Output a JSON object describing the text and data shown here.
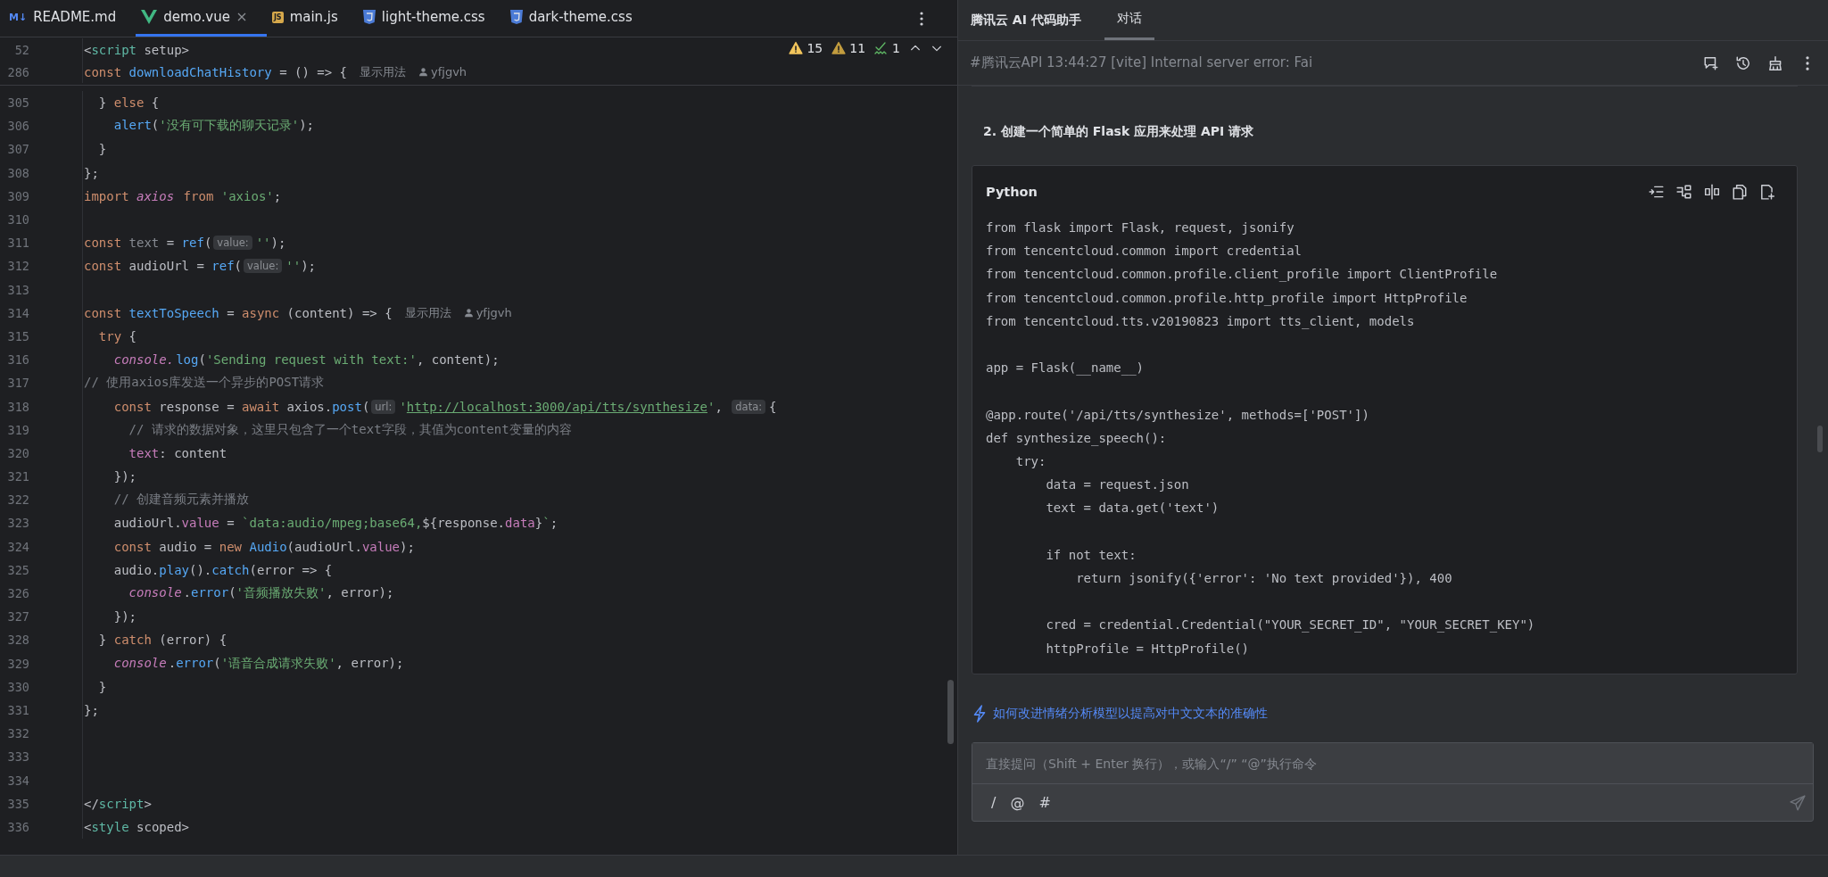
{
  "editor_tabs": [
    {
      "label": "README.md",
      "kind": "markdown",
      "icon_text": "M↓",
      "selected": false,
      "closable": false
    },
    {
      "label": "demo.vue",
      "kind": "vue",
      "selected": true,
      "closable": true
    },
    {
      "label": "main.js",
      "kind": "js",
      "icon_text": "JS",
      "selected": false,
      "closable": false
    },
    {
      "label": "light-theme.css",
      "kind": "css",
      "selected": false,
      "closable": false
    },
    {
      "label": "dark-theme.css",
      "kind": "css",
      "selected": false,
      "closable": false
    }
  ],
  "inspections": [
    {
      "kind": "warning",
      "count": "15"
    },
    {
      "kind": "weak_warning",
      "count": "11"
    },
    {
      "kind": "typo",
      "count": "1"
    }
  ],
  "sticky_lines": [
    {
      "number": "52",
      "tokens": [
        {
          "kind": "plain",
          "text": "<"
        },
        {
          "kind": "tag",
          "text": "script"
        },
        {
          "kind": "plain",
          "text": " setup>"
        }
      ]
    },
    {
      "number": "286",
      "tokens": [
        {
          "kind": "keyword",
          "text": "const "
        },
        {
          "kind": "function",
          "text": "downloadChatHistory"
        },
        {
          "kind": "plain",
          "text": " = () => {"
        }
      ],
      "usages": "显示用法",
      "author": "yfjgvh"
    }
  ],
  "lines": [
    {
      "number": "305",
      "tokens": [
        {
          "kind": "plain",
          "text": "  } "
        },
        {
          "kind": "keyword",
          "text": "else"
        },
        {
          "kind": "plain",
          "text": " {"
        }
      ]
    },
    {
      "number": "306",
      "tokens": [
        {
          "kind": "function",
          "text": "    alert"
        },
        {
          "kind": "plain",
          "text": "("
        },
        {
          "kind": "string",
          "text": "'没有可下载的聊天记录'"
        },
        {
          "kind": "plain",
          "text": ");"
        }
      ]
    },
    {
      "number": "307",
      "tokens": [
        {
          "kind": "plain",
          "text": "  }"
        }
      ]
    },
    {
      "number": "308",
      "tokens": [
        {
          "kind": "plain",
          "text": "};"
        }
      ]
    },
    {
      "number": "309",
      "tokens": [
        {
          "kind": "keyword",
          "text": "import "
        },
        {
          "kind": "global",
          "text": "axios"
        },
        {
          "kind": "keyword",
          "text": " from "
        },
        {
          "kind": "string",
          "text": "'axios'"
        },
        {
          "kind": "plain",
          "text": ";"
        }
      ]
    },
    {
      "number": "310"
    },
    {
      "number": "311",
      "tokens": [
        {
          "kind": "keyword",
          "text": "const "
        },
        {
          "kind": "unused",
          "text": "text"
        },
        {
          "kind": "plain",
          "text": " = "
        },
        {
          "kind": "function",
          "text": "ref"
        },
        {
          "kind": "plain",
          "text": "("
        },
        {
          "kind": "hint",
          "text": "value:"
        },
        {
          "kind": "string",
          "text": "''"
        },
        {
          "kind": "plain",
          "text": ");"
        }
      ]
    },
    {
      "number": "312",
      "tokens": [
        {
          "kind": "keyword",
          "text": "const "
        },
        {
          "kind": "plain",
          "text": "audioUrl = "
        },
        {
          "kind": "function",
          "text": "ref"
        },
        {
          "kind": "plain",
          "text": "("
        },
        {
          "kind": "hint",
          "text": "value:"
        },
        {
          "kind": "string",
          "text": "''"
        },
        {
          "kind": "plain",
          "text": ");"
        }
      ]
    },
    {
      "number": "313"
    },
    {
      "number": "314",
      "tokens": [
        {
          "kind": "keyword",
          "text": "const "
        },
        {
          "kind": "function",
          "text": "textToSpeech"
        },
        {
          "kind": "plain",
          "text": " = "
        },
        {
          "kind": "keyword",
          "text": "async "
        },
        {
          "kind": "plain",
          "text": "(content) => {"
        }
      ],
      "usages": "显示用法",
      "author": "yfjgvh"
    },
    {
      "number": "315",
      "tokens": [
        {
          "kind": "keyword",
          "text": "  try"
        },
        {
          "kind": "plain",
          "text": " {"
        }
      ]
    },
    {
      "number": "316",
      "tokens": [
        {
          "kind": "global",
          "text": "    console."
        },
        {
          "kind": "function",
          "text": "log"
        },
        {
          "kind": "plain",
          "text": "("
        },
        {
          "kind": "string",
          "text": "'Sending request with text:'"
        },
        {
          "kind": "plain",
          "text": ", content);"
        }
      ]
    },
    {
      "number": "317",
      "tokens": [
        {
          "kind": "comment",
          "text": "// 使用axios库发送一个异步的POST请求"
        }
      ]
    },
    {
      "number": "318",
      "tokens": [
        {
          "kind": "keyword",
          "text": "    const "
        },
        {
          "kind": "plain",
          "text": "response = "
        },
        {
          "kind": "keyword",
          "text": "await "
        },
        {
          "kind": "plain",
          "text": "axios."
        },
        {
          "kind": "function",
          "text": "post"
        },
        {
          "kind": "plain",
          "text": "("
        },
        {
          "kind": "hint",
          "text": "url:"
        },
        {
          "kind": "string",
          "text": "'"
        },
        {
          "kind": "url",
          "text": "http://localhost:3000/api/tts/synthesize"
        },
        {
          "kind": "string",
          "text": "'"
        },
        {
          "kind": "plain",
          "text": ", "
        },
        {
          "kind": "hint",
          "text": "data:"
        },
        {
          "kind": "plain",
          "text": "{"
        }
      ]
    },
    {
      "number": "319",
      "tokens": [
        {
          "kind": "comment",
          "text": "      // 请求的数据对象，这里只包含了一个text字段，其值为content变量的内容"
        }
      ]
    },
    {
      "number": "320",
      "tokens": [
        {
          "kind": "property",
          "text": "      text"
        },
        {
          "kind": "plain",
          "text": ": content"
        }
      ]
    },
    {
      "number": "321",
      "tokens": [
        {
          "kind": "plain",
          "text": "    });"
        }
      ]
    },
    {
      "number": "322",
      "tokens": [
        {
          "kind": "comment",
          "text": "    // 创建音频元素并播放"
        }
      ]
    },
    {
      "number": "323",
      "tokens": [
        {
          "kind": "plain",
          "text": "    audioUrl."
        },
        {
          "kind": "property",
          "text": "value"
        },
        {
          "kind": "plain",
          "text": " = "
        },
        {
          "kind": "string",
          "text": "`data:audio/mpeg;base64,"
        },
        {
          "kind": "plain",
          "text": "${response."
        },
        {
          "kind": "property",
          "text": "data"
        },
        {
          "kind": "plain",
          "text": "}"
        },
        {
          "kind": "string",
          "text": "`"
        },
        {
          "kind": "plain",
          "text": ";"
        }
      ]
    },
    {
      "number": "324",
      "tokens": [
        {
          "kind": "keyword",
          "text": "    const "
        },
        {
          "kind": "plain",
          "text": "audio = "
        },
        {
          "kind": "keyword",
          "text": "new "
        },
        {
          "kind": "function",
          "text": "Audio"
        },
        {
          "kind": "plain",
          "text": "(audioUrl."
        },
        {
          "kind": "property",
          "text": "value"
        },
        {
          "kind": "plain",
          "text": ");"
        }
      ]
    },
    {
      "number": "325",
      "tokens": [
        {
          "kind": "plain",
          "text": "    audio."
        },
        {
          "kind": "function",
          "text": "play"
        },
        {
          "kind": "plain",
          "text": "()."
        },
        {
          "kind": "function",
          "text": "catch"
        },
        {
          "kind": "plain",
          "text": "(error => {"
        }
      ]
    },
    {
      "number": "326",
      "tokens": [
        {
          "kind": "global",
          "text": "      console"
        },
        {
          "kind": "plain",
          "text": "."
        },
        {
          "kind": "function",
          "text": "error"
        },
        {
          "kind": "plain",
          "text": "("
        },
        {
          "kind": "string",
          "text": "'音频播放失败'"
        },
        {
          "kind": "plain",
          "text": ", error);"
        }
      ]
    },
    {
      "number": "327",
      "tokens": [
        {
          "kind": "plain",
          "text": "    });"
        }
      ]
    },
    {
      "number": "328",
      "tokens": [
        {
          "kind": "plain",
          "text": "  } "
        },
        {
          "kind": "keyword",
          "text": "catch "
        },
        {
          "kind": "plain",
          "text": "(error) {"
        }
      ]
    },
    {
      "number": "329",
      "tokens": [
        {
          "kind": "global",
          "text": "    console"
        },
        {
          "kind": "plain",
          "text": "."
        },
        {
          "kind": "function",
          "text": "error"
        },
        {
          "kind": "plain",
          "text": "("
        },
        {
          "kind": "string",
          "text": "'语音合成请求失败'"
        },
        {
          "kind": "plain",
          "text": ", error);"
        }
      ]
    },
    {
      "number": "330",
      "tokens": [
        {
          "kind": "plain",
          "text": "  }"
        }
      ]
    },
    {
      "number": "331",
      "tokens": [
        {
          "kind": "plain",
          "text": "};"
        }
      ]
    },
    {
      "number": "332"
    },
    {
      "number": "333"
    },
    {
      "number": "334"
    },
    {
      "number": "335",
      "tokens": [
        {
          "kind": "plain",
          "text": "</"
        },
        {
          "kind": "tag",
          "text": "script"
        },
        {
          "kind": "plain",
          "text": ">"
        }
      ]
    },
    {
      "number": "336",
      "tokens": [
        {
          "kind": "plain",
          "text": "<"
        },
        {
          "kind": "tag",
          "text": "style"
        },
        {
          "kind": "plain",
          "text": " scoped>"
        }
      ]
    }
  ],
  "assistant": {
    "title": "腾讯云 AI 代码助手",
    "tabs": [
      {
        "label": "对话",
        "selected": true
      }
    ],
    "session": "#腾讯云API 13:44:27 [vite] Internal server error: Fai",
    "step": "2. 创建一个简单的 Flask 应用来处理 API 请求",
    "code_block": {
      "language": "Python",
      "code": "from flask import Flask, request, jsonify\nfrom tencentcloud.common import credential\nfrom tencentcloud.common.profile.client_profile import ClientProfile\nfrom tencentcloud.common.profile.http_profile import HttpProfile\nfrom tencentcloud.tts.v20190823 import tts_client, models\n\napp = Flask(__name__)\n\n@app.route('/api/tts/synthesize', methods=['POST'])\ndef synthesize_speech():\n    try:\n        data = request.json\n        text = data.get('text')\n\n        if not text:\n            return jsonify({'error': 'No text provided'}), 400\n\n        cred = credential.Credential(\"YOUR_SECRET_ID\", \"YOUR_SECRET_KEY\")\n        httpProfile = HttpProfile()"
    },
    "suggestion": "如何改进情绪分析模型以提高对中文文本的准确性",
    "input": {
      "placeholder": "直接提问（Shift + Enter 换行），或输入“/” “@”执行命令"
    },
    "input_tools": [
      "/",
      "@",
      "#"
    ]
  }
}
